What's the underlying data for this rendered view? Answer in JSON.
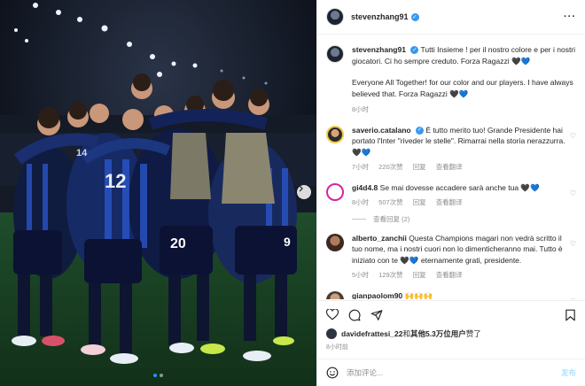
{
  "post": {
    "username": "stevenzhang91",
    "more_icon": "more-horizontal-icon",
    "caption_line1": "Tutti Insieme ! per il nostro colore e per i nostri giocatori. Ci ho sempre creduto. Forza Ragazzi 🖤💙",
    "caption_line2": "Everyone All Together! for our color and our players. I have always believed that. Forza Ragazzi 🖤💙",
    "caption_time": "8小时"
  },
  "comments": [
    {
      "username": "saverio.catalano",
      "verified": true,
      "text": "È tutto merito tuo! Grande Presidente hai portato l'Inter \"riveder le stelle\". Rimarrai nella storia nerazzurra. 🖤💙",
      "time": "7小时",
      "likes": "220次赞",
      "reply": "回复",
      "translate": "查看翻译"
    },
    {
      "username": "gi4d4.8",
      "verified": false,
      "text": "Se mai dovesse accadere sarà anche tua 🖤💙",
      "time": "8小时",
      "likes": "507次赞",
      "reply": "回复",
      "translate": "查看翻译",
      "view_replies": "查看回复 (2)"
    },
    {
      "username": "alberto_zanchii",
      "verified": false,
      "text": "Questa Champions magari non vedrà scritto il tuo nome, ma i nostri cuori non lo dimenticheranno mai. Tutto è iniziato con te 🖤💙 eternamente grati, presidente.",
      "time": "5小时",
      "likes": "129次赞",
      "reply": "回复",
      "translate": "查看翻译"
    },
    {
      "username": "gianpaolom90",
      "verified": false,
      "text": "🙌🙌🙌"
    }
  ],
  "likes_line": {
    "user": "davidefrattesi_22",
    "and": "和",
    "others": "其他5.3万位用户",
    "suffix": "赞了"
  },
  "post_time": "8小时前",
  "add_comment": {
    "placeholder": "添加评论...",
    "post_label": "发布"
  },
  "colors": {
    "verified": "#3897f0",
    "post_button": "#b2dffc",
    "inter_blue": "#1e3a8a"
  }
}
